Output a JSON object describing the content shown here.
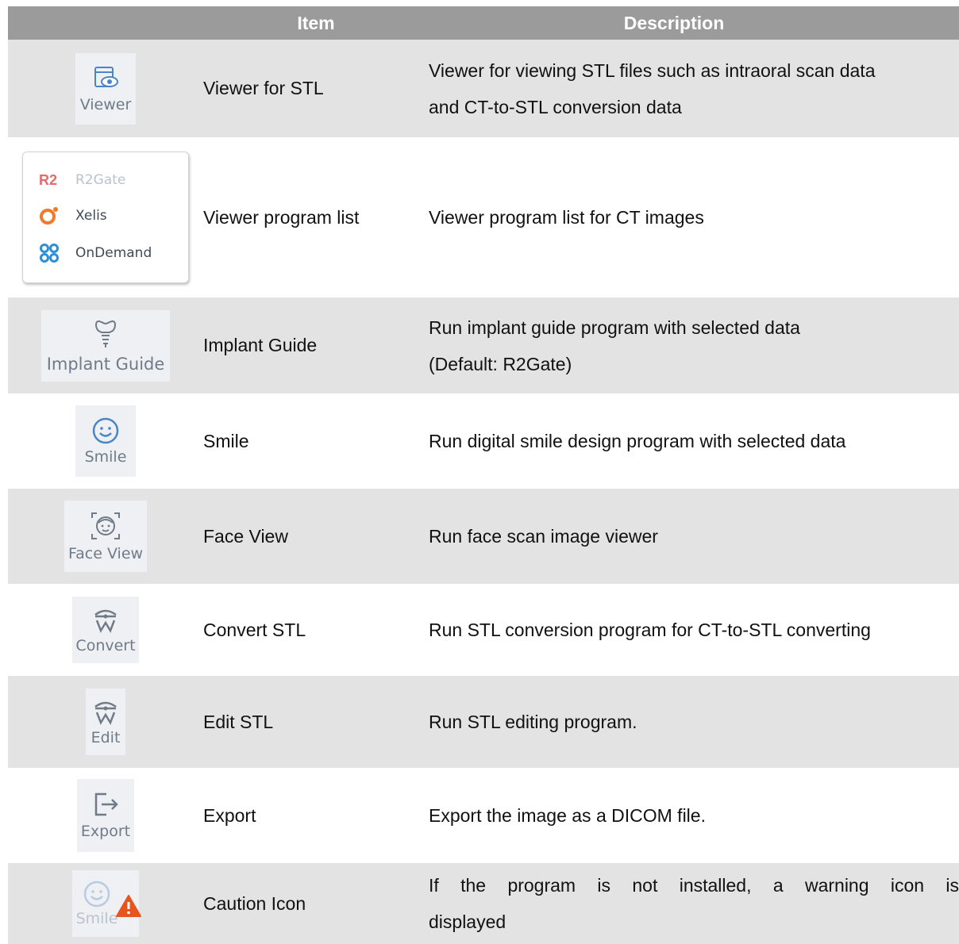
{
  "header": {
    "item": "Item",
    "description": "Description"
  },
  "rows": [
    {
      "icon_label": "Viewer",
      "icon": "viewer-icon",
      "item": "Viewer for STL",
      "desc": [
        "Viewer for viewing STL files such as intraoral scan data",
        "and CT-to-STL conversion data"
      ]
    },
    {
      "icon": "program-list",
      "item": "Viewer program list",
      "program_list": [
        {
          "badge": "R2",
          "label": "R2Gate",
          "icon": "r2gate-icon",
          "color": "#e26b6b"
        },
        {
          "label": "Xelis",
          "icon": "xelis-icon",
          "color": "#f07a2a"
        },
        {
          "label": "OnDemand",
          "icon": "ondemand-icon",
          "color": "#2d8fd6"
        }
      ],
      "desc": [
        "Viewer program list for CT images"
      ]
    },
    {
      "icon_label": "Implant Guide",
      "icon": "implant-icon",
      "item": "Implant Guide",
      "desc": [
        "Run implant guide program with selected data",
        "(Default: R2Gate)"
      ]
    },
    {
      "icon_label": "Smile",
      "icon": "smile-icon",
      "item": "Smile",
      "desc": [
        "Run digital smile design program with selected data"
      ]
    },
    {
      "icon_label": "Face View",
      "icon": "face-view-icon",
      "item": "Face View",
      "desc": [
        "Run face scan image viewer"
      ]
    },
    {
      "icon_label": "Convert",
      "icon": "convert-icon",
      "item": "Convert STL",
      "desc": [
        "Run STL conversion program for CT-to-STL converting"
      ]
    },
    {
      "icon_label": "Edit",
      "icon": "edit-icon",
      "item": "Edit STL",
      "desc": [
        "Run STL editing program."
      ]
    },
    {
      "icon_label": "Export",
      "icon": "export-icon",
      "item": "Export",
      "desc": [
        "Export the image as a DICOM file."
      ]
    },
    {
      "icon_label": "Smile",
      "icon": "caution-icon",
      "item": "Caution Icon",
      "desc": [
        "If the program is not installed, a warning icon is",
        "displayed"
      ]
    }
  ],
  "colors": {
    "header_bg": "#9b9b9b",
    "shade_bg": "#e3e3e3",
    "icon_color": "#6f7b88",
    "warning": "#e8541e"
  }
}
